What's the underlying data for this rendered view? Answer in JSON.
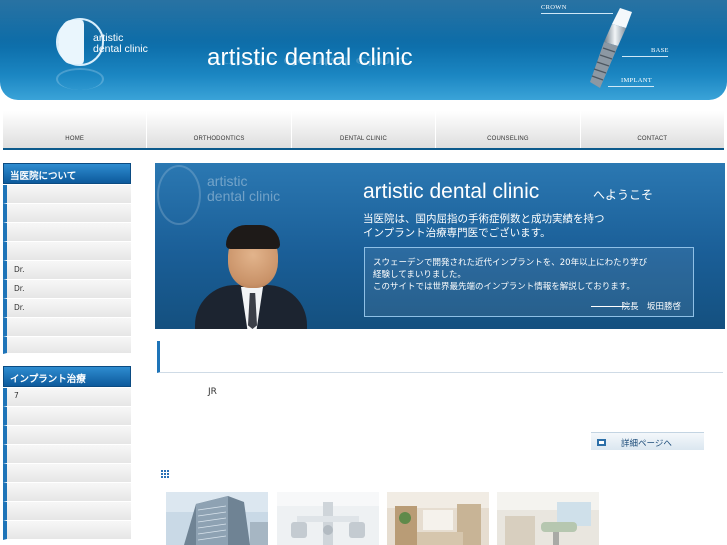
{
  "header": {
    "logo_text_line1": "artistic",
    "logo_text_line2": "dental clinic",
    "site_title": "artistic dental clinic",
    "implant_labels": [
      "CROWN",
      "BASE",
      "IMPLANT"
    ]
  },
  "nav": {
    "items": [
      {
        "label": "HOME"
      },
      {
        "label": "ORTHODONTICS"
      },
      {
        "label": "DENTAL CLINIC"
      },
      {
        "label": "COUNSELING"
      },
      {
        "label": "CONTACT"
      }
    ]
  },
  "sidebar": {
    "section1": {
      "title": "当医院について",
      "items": [
        {
          "label": ""
        },
        {
          "label": ""
        },
        {
          "label": ""
        },
        {
          "label": ""
        },
        {
          "label": "Dr."
        },
        {
          "label": "Dr."
        },
        {
          "label": "Dr."
        },
        {
          "label": ""
        },
        {
          "label": ""
        }
      ]
    },
    "section2": {
      "title": "インプラント治療",
      "items": [
        {
          "label": "7"
        },
        {
          "label": ""
        },
        {
          "label": ""
        },
        {
          "label": ""
        },
        {
          "label": ""
        },
        {
          "label": ""
        },
        {
          "label": ""
        },
        {
          "label": ""
        }
      ]
    }
  },
  "banner": {
    "watermark_line1": "artistic",
    "watermark_line2": "dental clinic",
    "title": "artistic dental clinic",
    "title_suffix": "へようこそ",
    "line1": "当医院は、国内屈指の手術症例数と成功実績を持つ",
    "line2": "インプラント治療専門医でございます。",
    "message_line1": "スウェーデンで開発された近代インプラントを、20年以上にわたり学び",
    "message_line2": "経験してまいりました。",
    "message_line3": "このサイトでは世界最先端のインプラント情報を解説しております。",
    "signature": "院長　坂田勝啓"
  },
  "content": {
    "text_jr": "JR",
    "more_button_label": "詳細ページへ"
  },
  "photos": [
    {
      "name": "building-photo"
    },
    {
      "name": "equipment-photo"
    },
    {
      "name": "reception-photo"
    },
    {
      "name": "treatment-room-photo"
    }
  ],
  "colors": {
    "brand_blue": "#0d5a8c",
    "accent_blue": "#1e74b8",
    "banner_blue": "#1a5e97"
  }
}
